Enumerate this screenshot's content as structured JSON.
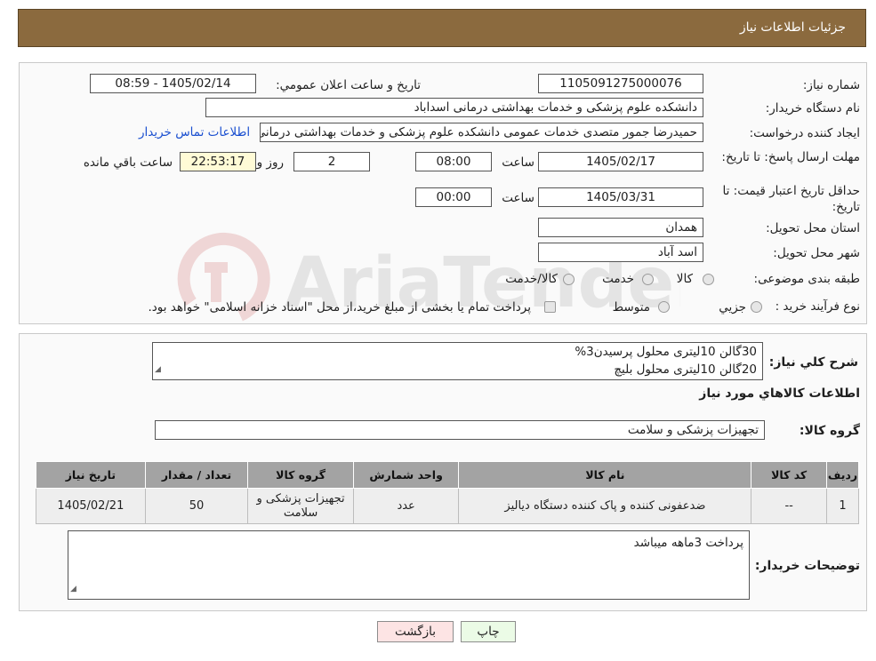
{
  "header": {
    "title": "جزئیات اطلاعات نیاز"
  },
  "form": {
    "need_number_label": "شماره نیاز:",
    "need_number": "1105091275000076",
    "announce_label": "تاریخ و ساعت اعلان عمومي:",
    "announce_value": "1405/02/14 - 08:59",
    "buyer_org_label": "نام دستگاه خريدار:",
    "buyer_org": "دانشکده علوم پزشکی و خدمات بهداشتی درمانی اسداباد",
    "requester_label": "ايجاد کننده درخواست:",
    "requester": "حمیدرضا جمور متصدی خدمات عمومی  دانشکده علوم پزشکی و خدمات بهداشتی درمانی اسداباد",
    "contact_link": "اطلاعات تماس خريدار",
    "deadline_label": "مهلت ارسال پاسخ: تا تاریخ:",
    "deadline_date": "1405/02/17",
    "time_label": "ساعت",
    "deadline_time": "08:00",
    "days_value": "2",
    "days_label": "روز و",
    "remaining_time": "22:53:17",
    "remaining_label": "ساعت باقي مانده",
    "validity_label": "حداقل تاريخ اعتبار قيمت: تا تاریخ:",
    "validity_date": "1405/03/31",
    "validity_time": "00:00",
    "province_label": "استان محل تحويل:",
    "province": "همدان",
    "city_label": "شهر محل تحويل:",
    "city": "اسد آباد",
    "category_label": "طبقه بندی موضوعی:",
    "category_options": [
      "کالا",
      "خدمت",
      "کالا/خدمت"
    ],
    "process_label": "نوع فرآيند خريد :",
    "process_options": [
      "جزيي",
      "متوسط"
    ],
    "payment_note": "پرداخت تمام يا بخشی از مبلغ خريد،از محل \"اسناد خزانه اسلامی\" خواهد بود."
  },
  "watermark": {
    "text": "AriaTender.neT"
  },
  "description": {
    "label": "شرح کلي نياز:",
    "lines": [
      "30گالن 10لیتری محلول پرسیدن3%",
      "20گالن 10لیتری محلول بلیچ"
    ]
  },
  "goods_info": {
    "title": "اطلاعات کالاهاي مورد نياز",
    "group_label": "گروه کالا:",
    "group_value": "تجهیزات پزشکی و سلامت"
  },
  "table": {
    "headers": [
      "رديف",
      "کد کالا",
      "نام کالا",
      "واحد شمارش",
      "گروه کالا",
      "تعداد / مقدار",
      "تاريخ نياز"
    ],
    "rows": [
      {
        "row": "1",
        "code": "--",
        "name": "ضدعفونی کننده و پاک کننده دستگاه دیالیز",
        "unit": "عدد",
        "group": "تجهیزات پزشکی و سلامت",
        "qty": "50",
        "date": "1405/02/21"
      }
    ]
  },
  "buyer_notes": {
    "label": "توضيحات خريدار:",
    "text": "پرداخت 3ماهه میباشد"
  },
  "buttons": {
    "print": "چاپ",
    "back": "بازگشت"
  },
  "colors": {
    "header": "#8b6a3e",
    "yellow_field": "#fffbd6",
    "print_button": "#ebfbe6",
    "back_button": "#fde4e4",
    "link": "#1a4fd0"
  }
}
